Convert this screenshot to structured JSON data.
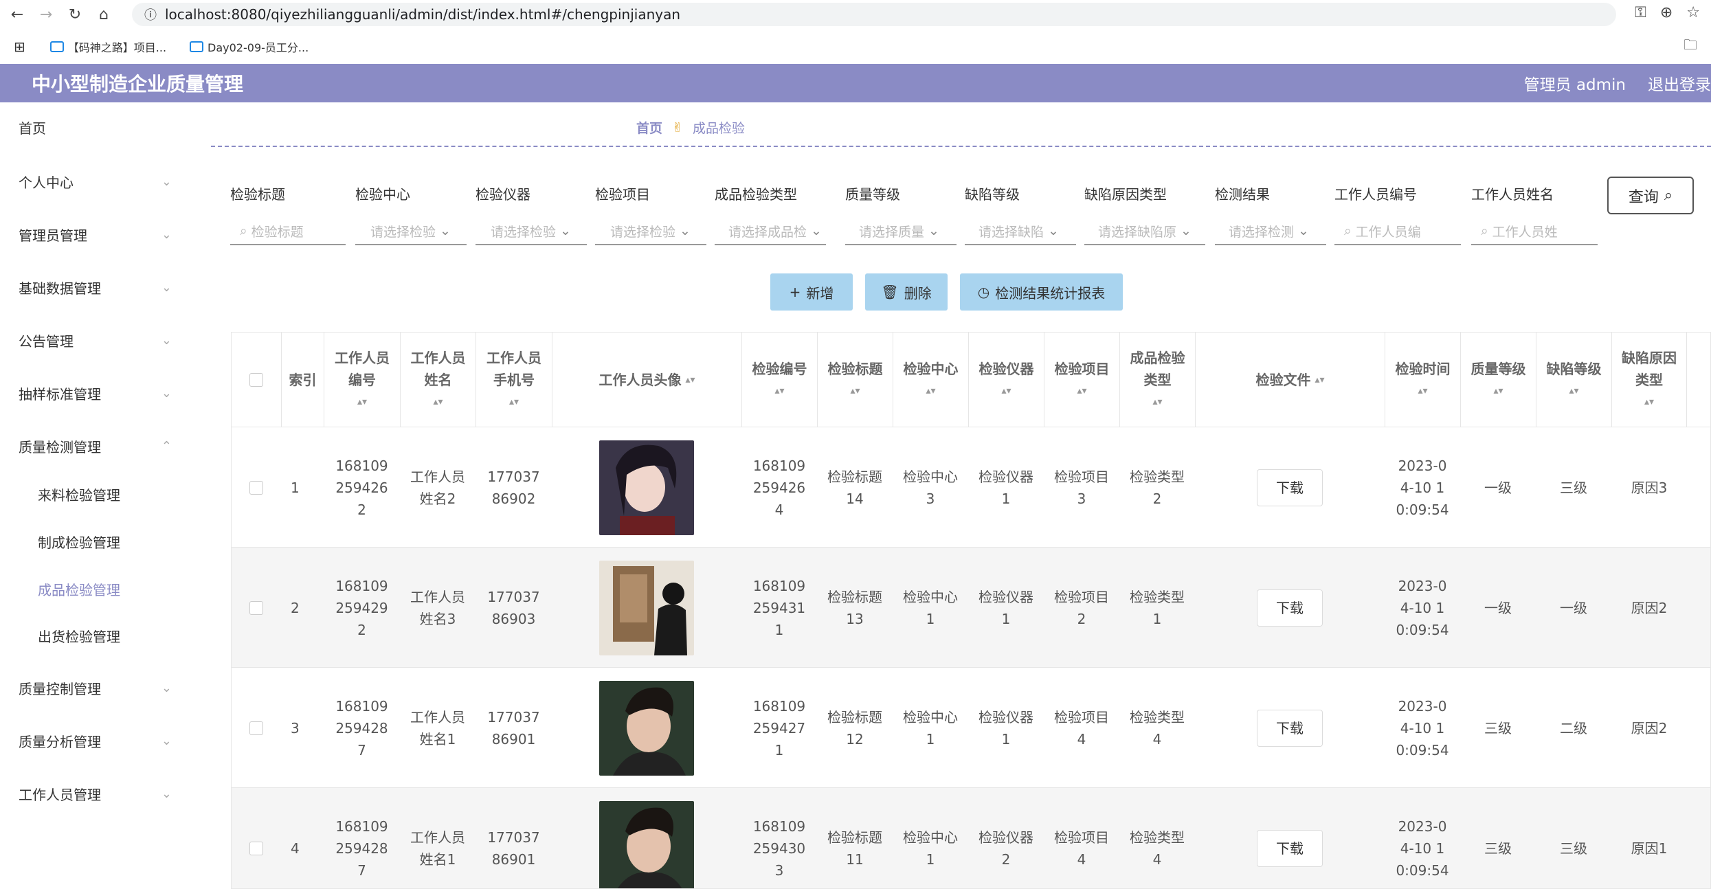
{
  "browser": {
    "url": "localhost:8080/qiyezhiliangguanli/admin/dist/index.html#/chengpinjianyan",
    "bookmarks": [
      "【码神之路】项目...",
      "Day02-09-员工分..."
    ]
  },
  "header": {
    "title": "中小型制造企业质量管理",
    "user": "管理员 admin",
    "logout": "退出登录"
  },
  "sidebar": {
    "items": [
      "首页",
      "个人中心",
      "管理员管理",
      "基础数据管理",
      "公告管理",
      "抽样标准管理",
      "质量检测管理",
      "来料检验管理",
      "制成检验管理",
      "成品检验管理",
      "出货检验管理",
      "质量控制管理",
      "质量分析管理",
      "工作人员管理"
    ]
  },
  "breadcrumb": {
    "home": "首页",
    "current": "成品检验"
  },
  "filters": [
    {
      "label": "检验标题",
      "placeholder": "检验标题"
    },
    {
      "label": "检验中心",
      "placeholder": "请选择检验"
    },
    {
      "label": "检验仪器",
      "placeholder": "请选择检验"
    },
    {
      "label": "检验项目",
      "placeholder": "请选择检验"
    },
    {
      "label": "成品检验类型",
      "placeholder": "请选择成品检"
    },
    {
      "label": "质量等级",
      "placeholder": "请选择质量"
    },
    {
      "label": "缺陷等级",
      "placeholder": "请选择缺陷"
    },
    {
      "label": "缺陷原因类型",
      "placeholder": "请选择缺陷原"
    },
    {
      "label": "检测结果",
      "placeholder": "请选择检测"
    },
    {
      "label": "工作人员编号",
      "placeholder": "工作人员编"
    },
    {
      "label": "工作人员姓名",
      "placeholder": "工作人员姓"
    }
  ],
  "query_label": "查询",
  "actions": {
    "add": "新增",
    "delete": "删除",
    "report": "检测结果统计报表"
  },
  "table": {
    "headers": [
      "索引",
      "工作人员编号",
      "工作人员姓名",
      "工作人员手机号",
      "工作人员头像",
      "检验编号",
      "检验标题",
      "检验中心",
      "检验仪器",
      "检验项目",
      "成品检验类型",
      "检验文件",
      "检验时间",
      "质量等级",
      "缺陷等级",
      "缺陷原因类型"
    ],
    "download_label": "下载",
    "rows": [
      {
        "idx": "1",
        "staff_no": "1681092594262",
        "staff_name": "工作人员姓名2",
        "phone": "17703786902",
        "check_no": "1681092594264",
        "title": "检验标题14",
        "center": "检验中心3",
        "instrument": "检验仪器1",
        "item": "检验项目3",
        "type": "检验类型2",
        "time": "2023-04-10 10:09:54",
        "quality": "一级",
        "defect": "三级",
        "reason": "原因3"
      },
      {
        "idx": "2",
        "staff_no": "1681092594292",
        "staff_name": "工作人员姓名3",
        "phone": "17703786903",
        "check_no": "1681092594311",
        "title": "检验标题13",
        "center": "检验中心1",
        "instrument": "检验仪器1",
        "item": "检验项目2",
        "type": "检验类型1",
        "time": "2023-04-10 10:09:54",
        "quality": "一级",
        "defect": "一级",
        "reason": "原因2"
      },
      {
        "idx": "3",
        "staff_no": "1681092594287",
        "staff_name": "工作人员姓名1",
        "phone": "17703786901",
        "check_no": "1681092594271",
        "title": "检验标题12",
        "center": "检验中心1",
        "instrument": "检验仪器1",
        "item": "检验项目4",
        "type": "检验类型4",
        "time": "2023-04-10 10:09:54",
        "quality": "三级",
        "defect": "二级",
        "reason": "原因2"
      },
      {
        "idx": "4",
        "staff_no": "1681092594287",
        "staff_name": "工作人员姓名1",
        "phone": "17703786901",
        "check_no": "1681092594303",
        "title": "检验标题11",
        "center": "检验中心1",
        "instrument": "检验仪器2",
        "item": "检验项目4",
        "type": "检验类型4",
        "time": "2023-04-10 10:09:54",
        "quality": "三级",
        "defect": "三级",
        "reason": "原因1"
      }
    ]
  }
}
